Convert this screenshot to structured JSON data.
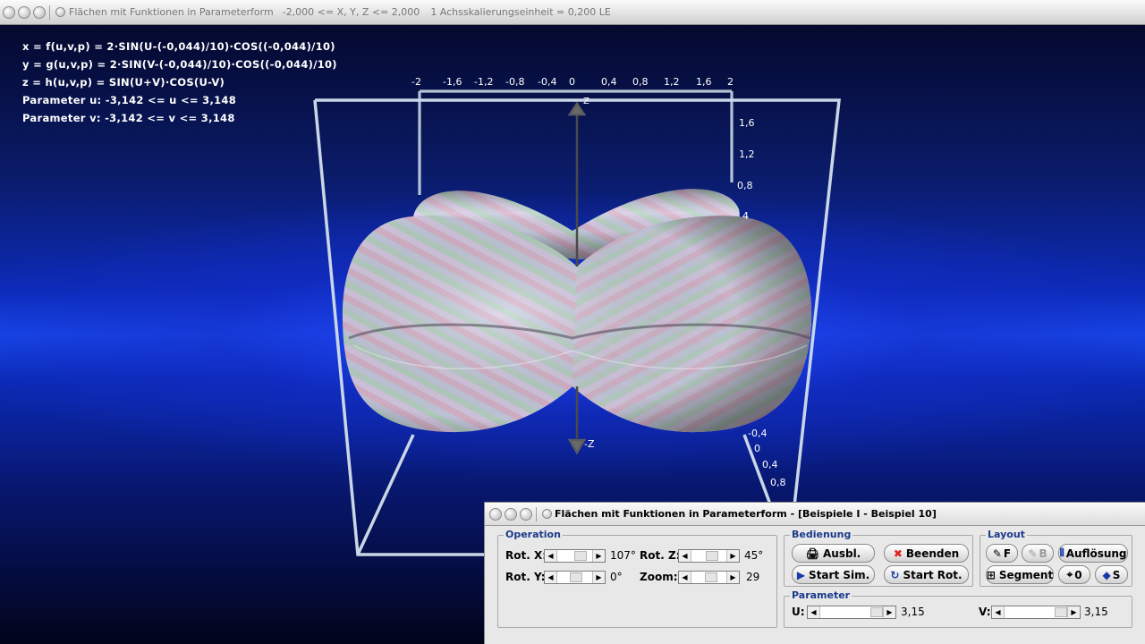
{
  "window": {
    "title": "Flächen mit Funktionen in Parameterform",
    "range": "-2,000 <= X, Y, Z <= 2,000",
    "scale": "1 Achsskalierungseinheit = 0,200 LE"
  },
  "formulas": [
    "x = f(u,v,p) = 2·SIN(U-(-0,044)/10)·COS((-0,044)/10)",
    "y = g(u,v,p) = 2·SIN(V-(-0,044)/10)·COS((-0,044)/10)",
    "z = h(u,v,p) = SIN(U+V)·COS(U-V)",
    "Parameter u: -3,142 <= u <= 3,148",
    "Parameter v: -3,142 <= v <= 3,148"
  ],
  "axes": {
    "top_ticks": [
      "-2",
      "-1,6",
      "-1,2",
      "-0,8",
      "-0,4",
      "0",
      "0,4",
      "0,8",
      "1,2",
      "1,6",
      "2"
    ],
    "right_ticks": [
      "1,6",
      "1,2",
      "0,8",
      "4"
    ],
    "bottom_ticks": [
      "-0,4",
      "0",
      "0,4",
      "0,8"
    ],
    "z_label": "Z",
    "neg_z_label": "-Z"
  },
  "dialog": {
    "title": "Flächen mit Funktionen in Parameterform - [Beispiele I - Beispiel 10]",
    "operation": {
      "legend": "Operation",
      "rot_x_label": "Rot. X:",
      "rot_x_value": "107°",
      "rot_y_label": "Rot. Y:",
      "rot_y_value": "0°",
      "rot_z_label": "Rot. Z:",
      "rot_z_value": "45°",
      "zoom_label": "Zoom:",
      "zoom_value": "29"
    },
    "bedienung": {
      "legend": "Bedienung",
      "ausbl": "Ausbl.",
      "beenden": "Beenden",
      "start_sim": "Start Sim.",
      "start_rot": "Start Rot."
    },
    "layout": {
      "legend": "Layout",
      "f": "F",
      "b": "B",
      "aufloesung": "Auflösung",
      "segment": "Segment",
      "zero": "0",
      "s": "S"
    },
    "parameter": {
      "legend": "Parameter",
      "u_label": "U:",
      "u_value": "3,15",
      "v_label": "V:",
      "v_value": "3,15"
    }
  }
}
